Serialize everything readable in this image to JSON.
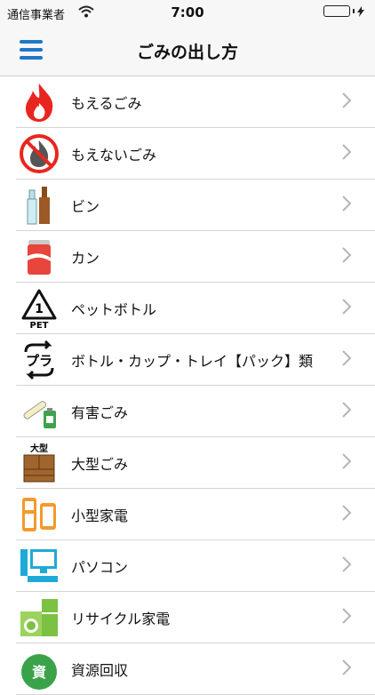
{
  "status_bar": {
    "carrier": "通信事業者",
    "time": "7:00"
  },
  "nav": {
    "title": "ごみの出し方"
  },
  "items": [
    {
      "label": "もえるごみ",
      "icon": "flame-icon"
    },
    {
      "label": "もえないごみ",
      "icon": "no-burn-icon"
    },
    {
      "label": "ビン",
      "icon": "bottle-icon"
    },
    {
      "label": "カン",
      "icon": "can-icon"
    },
    {
      "label": "ペットボトル",
      "icon": "pet-recycle-icon"
    },
    {
      "label": "ボトル・カップ・トレイ【パック】類",
      "icon": "plastic-recycle-icon"
    },
    {
      "label": "有害ごみ",
      "icon": "hazardous-icon"
    },
    {
      "label": "大型ごみ",
      "icon": "large-furniture-icon",
      "icon_text": "大型"
    },
    {
      "label": "小型家電",
      "icon": "small-appliance-icon"
    },
    {
      "label": "パソコン",
      "icon": "computer-icon"
    },
    {
      "label": "リサイクル家電",
      "icon": "recycle-appliance-icon"
    },
    {
      "label": "資源回収",
      "icon": "resource-icon",
      "icon_text": "資"
    }
  ],
  "colors": {
    "accent": "#1f77c8",
    "battery": "#4cd964",
    "flame": "#e8261f"
  }
}
